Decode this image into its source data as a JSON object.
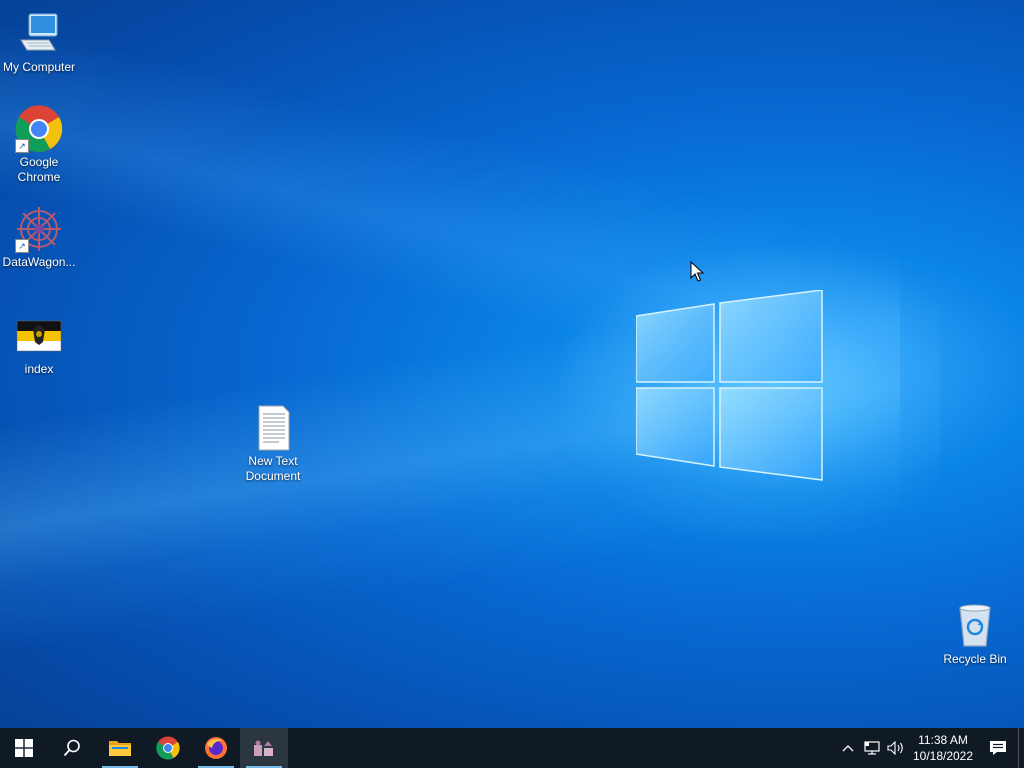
{
  "desktop": {
    "icons": [
      {
        "label": "My Computer",
        "icon": "computer-icon"
      },
      {
        "label": "Google Chrome",
        "icon": "chrome-icon"
      },
      {
        "label": "DataWagon...",
        "icon": "datawagon-icon"
      },
      {
        "label": "index",
        "icon": "flag-image-icon"
      },
      {
        "label": "New Text Document",
        "icon": "text-document-icon"
      },
      {
        "label": "Recycle Bin",
        "icon": "recycle-bin-icon"
      }
    ]
  },
  "taskbar": {
    "buttons": [
      {
        "name": "start",
        "icon": "windows-start-icon"
      },
      {
        "name": "search",
        "icon": "search-icon"
      },
      {
        "name": "file-explorer",
        "icon": "folder-icon"
      },
      {
        "name": "chrome",
        "icon": "chrome-icon"
      },
      {
        "name": "firefox",
        "icon": "firefox-icon"
      },
      {
        "name": "app",
        "icon": "app-icon"
      }
    ],
    "tray": {
      "time": "11:38 AM",
      "date": "10/18/2022"
    }
  },
  "colors": {
    "taskbar": "#101a24",
    "accent": "#76b9ed",
    "desktop": "#0766cf"
  }
}
